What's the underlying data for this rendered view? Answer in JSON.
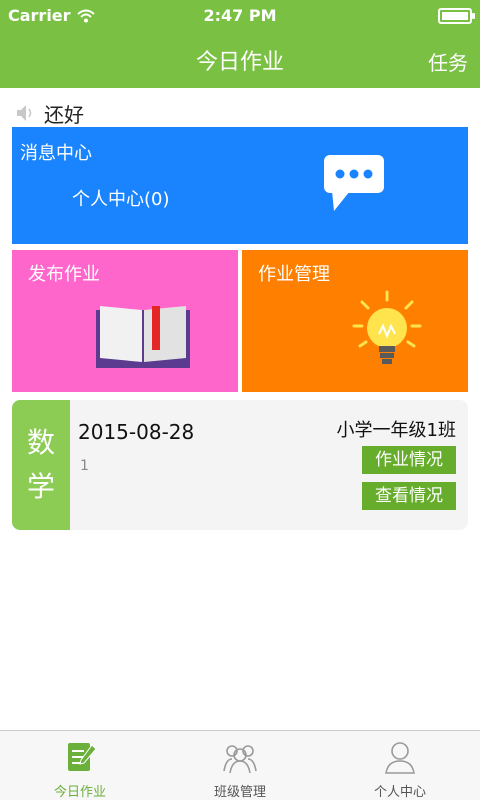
{
  "status_bar": {
    "carrier": "Carrier",
    "time": "2:47 PM"
  },
  "nav": {
    "title": "今日作业",
    "right_action": "任务"
  },
  "notice": {
    "text": "还好",
    "icon": "speaker-icon"
  },
  "tiles": {
    "messages": {
      "title": "消息中心",
      "subtitle": "个人中心(0)",
      "icon": "chat-bubble-icon",
      "color": "#1a84ff"
    },
    "publish": {
      "title": "发布作业",
      "icon": "book-icon",
      "color": "#ff66cc"
    },
    "manage": {
      "title": "作业管理",
      "icon": "lightbulb-icon",
      "color": "#ff7f00"
    }
  },
  "homework": {
    "subject_1": "数",
    "subject_2": "学",
    "date": "2015-08-28",
    "class_name": "小学一年级1班",
    "note": "1",
    "button_status": "作业情况",
    "button_view": "查看情况"
  },
  "tabbar": {
    "items": [
      {
        "label": "今日作业",
        "icon": "homework-icon",
        "active": true
      },
      {
        "label": "班级管理",
        "icon": "class-group-icon",
        "active": false
      },
      {
        "label": "个人中心",
        "icon": "person-icon",
        "active": false
      }
    ]
  },
  "colors": {
    "accent": "#7ac143",
    "button_green": "#67ad2c"
  }
}
